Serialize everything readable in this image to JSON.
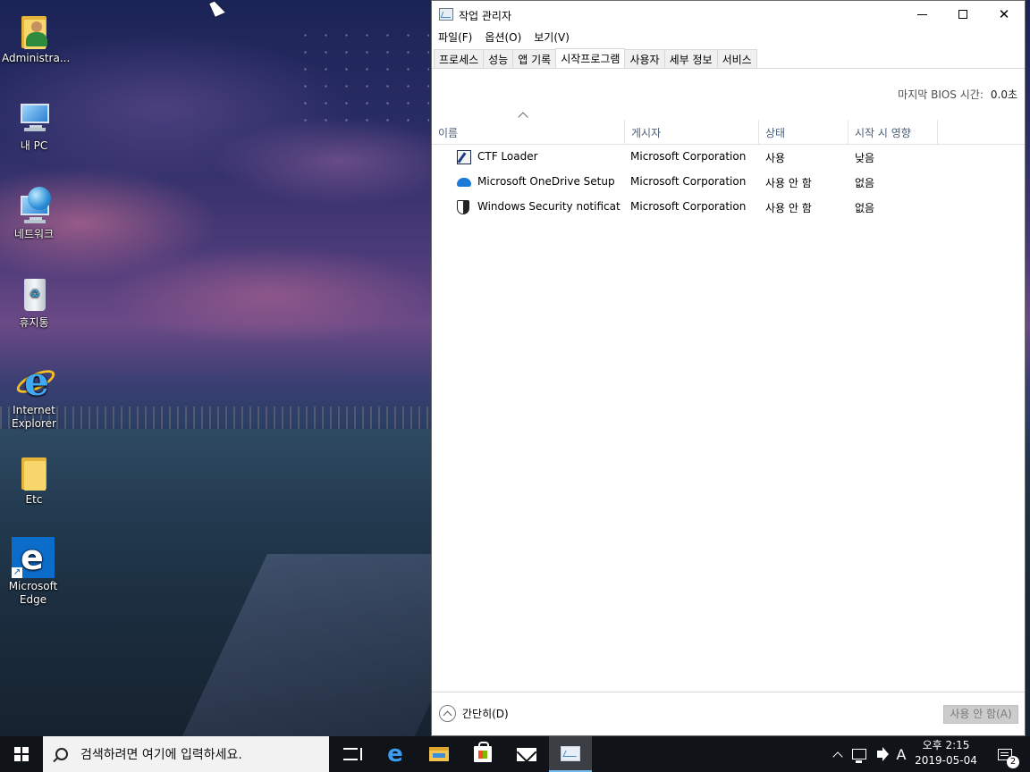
{
  "desktop": {
    "icons": [
      {
        "label": "Administra..."
      },
      {
        "label": "내 PC"
      },
      {
        "label": "네트워크"
      },
      {
        "label": "휴지통"
      },
      {
        "label": "Internet Explorer"
      },
      {
        "label": "Etc"
      },
      {
        "label": "Microsoft Edge"
      }
    ]
  },
  "window": {
    "title": "작업 관리자",
    "menu": [
      "파일(F)",
      "옵션(O)",
      "보기(V)"
    ],
    "tabs": [
      "프로세스",
      "성능",
      "앱 기록",
      "시작프로그램",
      "사용자",
      "세부 정보",
      "서비스"
    ],
    "active_tab": "시작프로그램",
    "bios_label": "마지막 BIOS 시간:",
    "bios_value": "0.0초",
    "columns": [
      "이름",
      "게시자",
      "상태",
      "시작 시 영향"
    ],
    "rows": [
      {
        "icon": "ctf-loader-icon",
        "name": "CTF Loader",
        "publisher": "Microsoft Corporation",
        "status": "사용",
        "impact": "낮음"
      },
      {
        "icon": "onedrive-cloud-icon",
        "name": "Microsoft OneDrive Setup",
        "publisher": "Microsoft Corporation",
        "status": "사용 안 함",
        "impact": "없음"
      },
      {
        "icon": "windows-security-shield-icon",
        "name": "Windows Security notificati...",
        "publisher": "Microsoft Corporation",
        "status": "사용 안 함",
        "impact": "없음"
      }
    ],
    "fewer_details_label": "간단히(D)",
    "disable_button_label": "사용 안 함(A)"
  },
  "taskbar": {
    "search_placeholder": "검색하려면 여기에 입력하세요.",
    "ime_label": "A",
    "clock_period_time": "오후 2:15",
    "clock_date": "2019-05-04",
    "notification_count": "2"
  }
}
